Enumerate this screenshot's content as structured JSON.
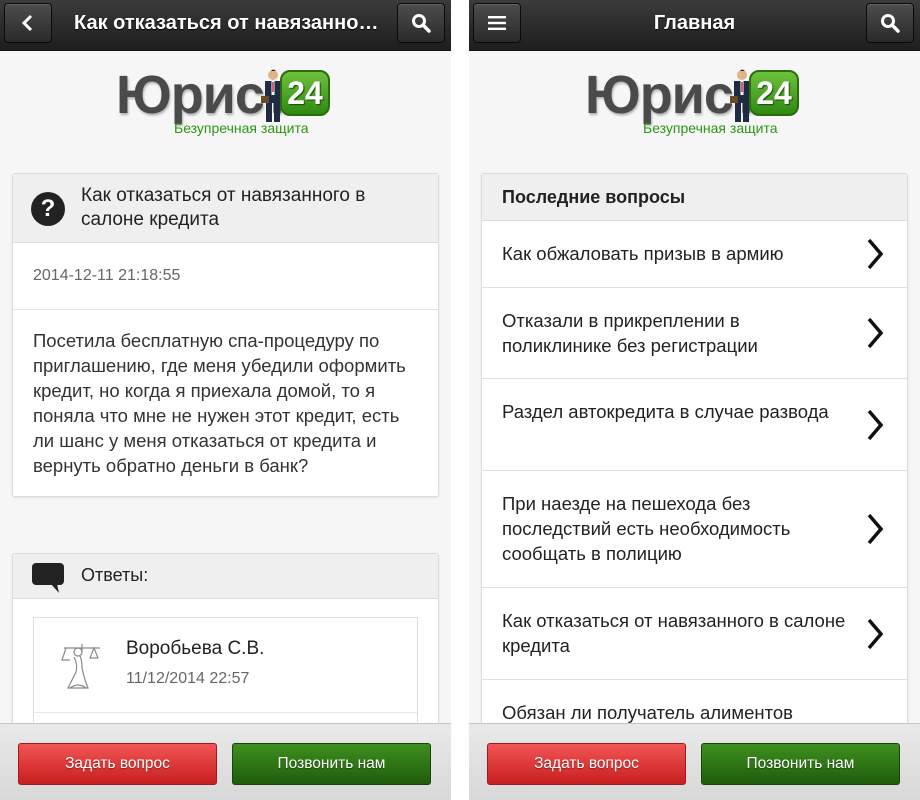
{
  "colors": {
    "header_bg": "#2a2a2a",
    "logo_green": "#2d9615",
    "ask_button": "#e03a3a",
    "call_button": "#2d7314"
  },
  "logo": {
    "word": "Юрист",
    "badge": "24",
    "tagline": "Безупречная защита"
  },
  "left": {
    "header": {
      "back_icon": "chevron-left-icon",
      "title": "Как отказаться от навязанного в салоне кредита",
      "search_icon": "search-icon"
    },
    "question": {
      "icon": "question-mark-icon",
      "title": "Как отказаться от навязанного в салоне кредита",
      "date": "2014-12-11 21:18:55",
      "body": "Посетила бесплатную спа-процедуру по приглашению, где меня убедили оформить кредит, но когда я приехала домой, то я поняла что мне не нужен этот кредит, есть ли шанс у меня отказаться от кредита и вернуть обратно деньги в банк?"
    },
    "answers": {
      "icon": "speech-bubble-icon",
      "title": "Ответы:",
      "items": [
        {
          "avatar": "themis-icon",
          "name": "Воробьева С.В.",
          "date": "11/12/2014 22:57"
        }
      ]
    }
  },
  "right": {
    "header": {
      "menu_icon": "menu-icon",
      "title": "Главная",
      "search_icon": "search-icon"
    },
    "latest": {
      "title": "Последние вопросы",
      "items": [
        {
          "label": "Как обжаловать призыв в армию"
        },
        {
          "label": "Отказали в прикреплении в поликлинике без регистрации"
        },
        {
          "label": "Раздел автокредита в случае развода"
        },
        {
          "label": "При наезде на пешехода без последствий есть необходимость сообщать в полицию"
        },
        {
          "label": "Как отказаться от навязанного в салоне кредита"
        },
        {
          "label": "Обязан ли получатель алиментов"
        }
      ]
    }
  },
  "footer": {
    "ask_label": "Задать вопрос",
    "call_label": "Позвонить нам"
  }
}
